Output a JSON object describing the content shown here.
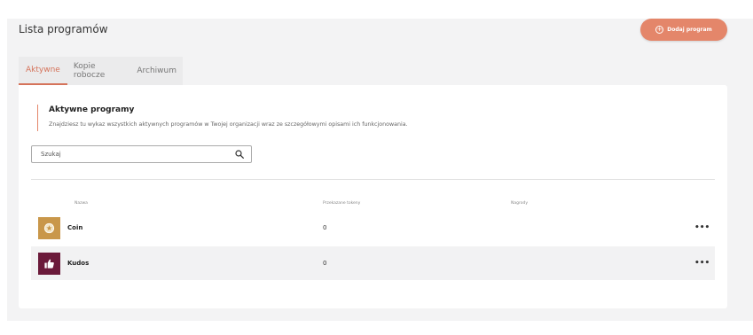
{
  "header": {
    "title": "Lista programów",
    "add_button_label": "Dodaj program",
    "add_button_icon": "plus-circle-icon",
    "accent_color": "#e4866a"
  },
  "tabs": [
    {
      "label": "Aktywne",
      "active": true
    },
    {
      "label": "Kopie robocze",
      "active": false
    },
    {
      "label": "Archiwum",
      "active": false
    }
  ],
  "section": {
    "title": "Aktywne programy",
    "description": "Znajdziesz tu wykaz wszystkich aktywnych programów w Twojej organizacji wraz ze szczegółowymi opisami ich funkcjonowania."
  },
  "search": {
    "placeholder": "Szukaj",
    "value": "",
    "icon": "search-icon"
  },
  "table": {
    "columns": [
      "Nazwa",
      "Przekazane tokeny",
      "Nagrody"
    ],
    "rows": [
      {
        "name": "Coin",
        "tokens": "0",
        "rewards": "",
        "icon": "star-coin-icon",
        "icon_color": "#c9974a",
        "menu": "•••"
      },
      {
        "name": "Kudos",
        "tokens": "0",
        "rewards": "",
        "icon": "thumbs-up-icon",
        "icon_color": "#6b1a3a",
        "menu": "•••"
      }
    ]
  }
}
